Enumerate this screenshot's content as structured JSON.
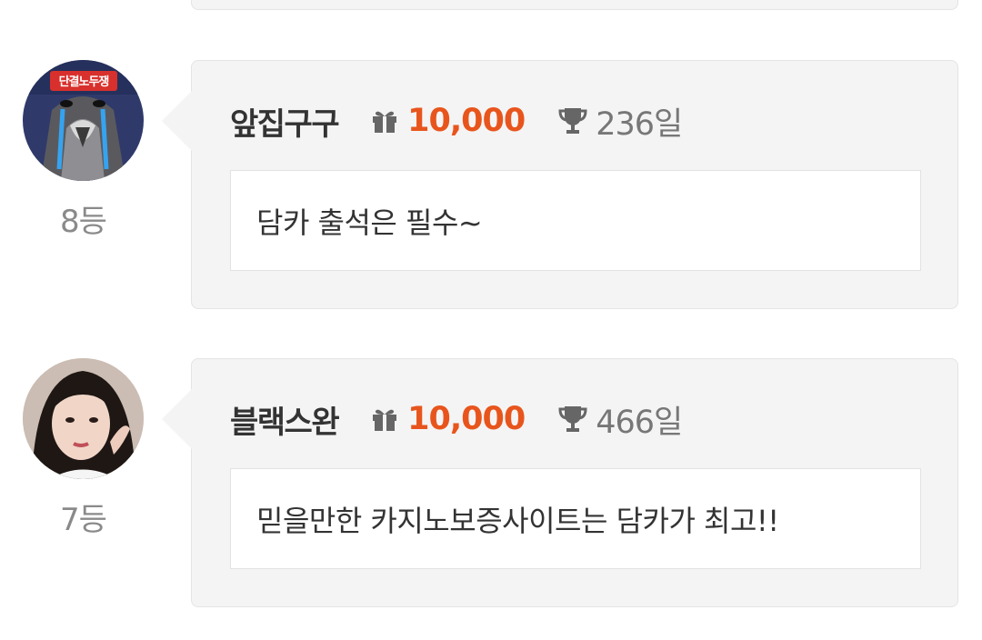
{
  "entries": [
    {
      "rank": "8등",
      "nickname": "앞집구구",
      "points": "10,000",
      "days": "236일",
      "message": "담카 출석은 필수~",
      "avatar_icon": "penguin-avatar",
      "avatar_sticker_text": "단결노두쟁"
    },
    {
      "rank": "7등",
      "nickname": "블랙스완",
      "points": "10,000",
      "days": "466일",
      "message": "믿을만한 카지노보증사이트는 담카가 최고!!",
      "avatar_icon": "user-photo-avatar"
    }
  ],
  "icons": {
    "points": "gift-icon",
    "days": "trophy-icon"
  },
  "colors": {
    "points": "#e8551c",
    "card_background": "#f4f4f4",
    "rank_text": "#8a8a8a"
  }
}
